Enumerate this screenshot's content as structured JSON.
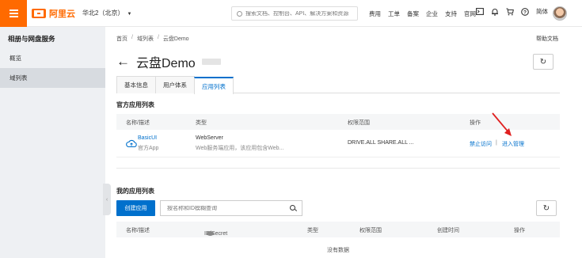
{
  "topbar": {
    "logo_text": "阿里云",
    "region": "华北2（北京）",
    "search_placeholder": "搜索文档、控制台、API、解决方案和资源",
    "nav_links": [
      "费用",
      "工单",
      "备案",
      "企业",
      "支持",
      "官网"
    ],
    "lang": "简体"
  },
  "sidebar": {
    "title": "相册与网盘服务",
    "items": [
      {
        "label": "概览",
        "active": false
      },
      {
        "label": "域列表",
        "active": true
      }
    ]
  },
  "breadcrumb": [
    "首页",
    "域列表",
    "云盘Demo"
  ],
  "help": "帮助文档",
  "page_title": "云盘Demo",
  "tabs": [
    {
      "label": "基本信息",
      "active": false
    },
    {
      "label": "用户体系",
      "active": false
    },
    {
      "label": "应用列表",
      "active": true
    }
  ],
  "official": {
    "title": "官方应用列表",
    "headers": [
      "名称/描述",
      "类型",
      "权限范围",
      "操作"
    ],
    "row": {
      "name": "BasicUI",
      "sub": "官方App",
      "type": "WebServer",
      "type_desc": "Web服务端应用，该应用包含Web...",
      "scope": "DRIVE.ALL  SHARE.ALL ...",
      "op_disable": "禁止访问",
      "op_sep": "|",
      "op_manage": "进入管理"
    }
  },
  "mine": {
    "title": "我的应用列表",
    "create_label": "创建应用",
    "filter_placeholder": "按名称和ID模糊查询",
    "headers": [
      "名称/描述",
      "ID/Secret",
      "类型",
      "权限范围",
      "创建时间",
      "操作"
    ],
    "empty": "没有数据"
  },
  "colors": {
    "brand": "#ff6a00",
    "link": "#0070cc",
    "annotation": "#e02020"
  }
}
